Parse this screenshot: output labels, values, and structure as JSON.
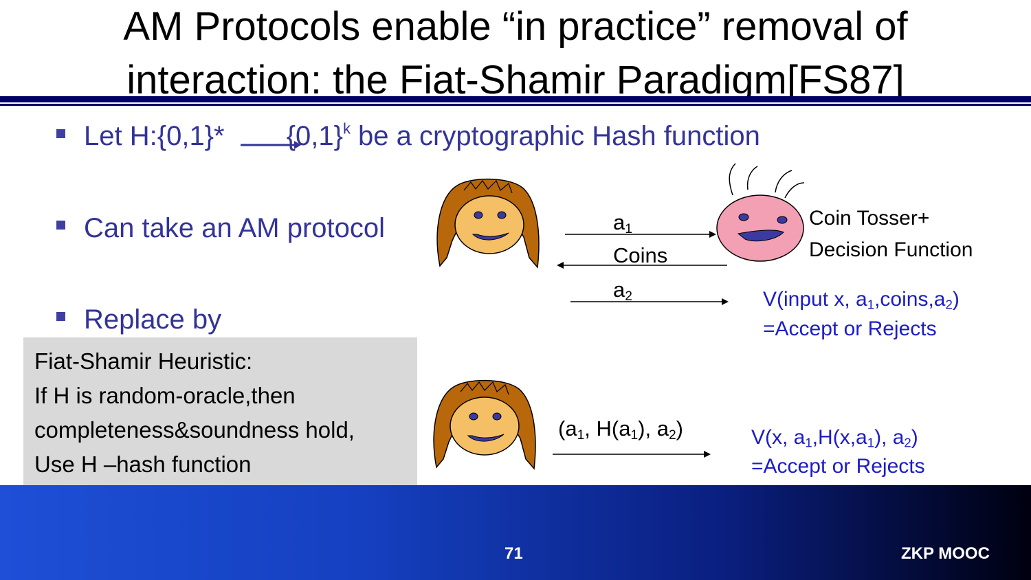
{
  "title": {
    "line1": "AM Protocols enable “in practice” removal of",
    "line2": "interaction: the Fiat-Shamir Paradigm[FS87]"
  },
  "bullets": {
    "b1": {
      "pre": "Let H:{0,1}*",
      "post": "{0,1}",
      "sup": "k",
      "rest": " be a cryptographic Hash function"
    },
    "b2": "Can take an AM protocol",
    "b3": "Replace by"
  },
  "protocol1": {
    "a": "a",
    "one": "1",
    "coins": "Coins",
    "two": "2",
    "verifier_label_1": "Coin Tosser+",
    "verifier_label_2": "Decision Function",
    "result": {
      "p1": "V(input x, a",
      "s1": "1",
      "p2": ",coins,a",
      "s2": "2",
      "p3": ")",
      "line2": "=Accept or Rejects"
    }
  },
  "heuristic_box": {
    "line1": "Fiat-Shamir Heuristic:",
    "line2": "If H is random-oracle,then",
    "line3": "completeness&soundness hold,",
    "line4": "Use H –hash function"
  },
  "protocol2": {
    "message": {
      "p1": "(a",
      "s1": "1",
      "p2": ", H(a",
      "s2": "1",
      "p3": "), a",
      "s3": "2",
      "p4": ")"
    },
    "result": {
      "p1": "V(x, a",
      "s1": "1",
      "p2": ",H(x,a",
      "s2": "1",
      "p3": "), a",
      "s3": "2",
      "p4": ")",
      "line2": "=Accept or Rejects"
    }
  },
  "footer": {
    "page": "71",
    "course": "ZKP MOOC"
  },
  "colors": {
    "bullet_text": "#333399",
    "result_text": "#1c1cc8",
    "rule": "#000066",
    "footer_left": "#1e4fd6",
    "footer_right": "#000010",
    "box": "#d9d9d9",
    "prover_hair": "#b8680a",
    "face": "#f5bf66",
    "verifier_face": "#f4a0b4",
    "mouth": "#3a3aa0"
  }
}
